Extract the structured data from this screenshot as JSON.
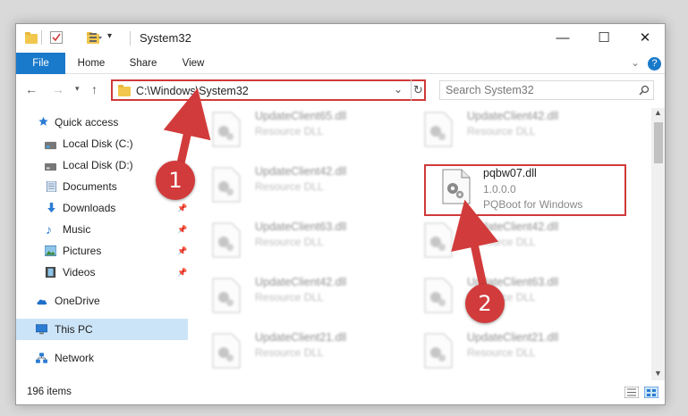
{
  "window": {
    "title": "System32",
    "minimize_glyph": "—",
    "maximize_glyph": "☐",
    "close_glyph": "✕"
  },
  "ribbon": {
    "tabs": [
      "File",
      "Home",
      "Share",
      "View"
    ],
    "expand_glyph": "⌄",
    "help_glyph": "?"
  },
  "address": {
    "path": "C:\\Windows\\System32",
    "search_placeholder": "Search System32"
  },
  "sidebar": {
    "items": [
      {
        "label": "Quick access",
        "icon": "star-icon"
      },
      {
        "label": "Local Disk (C:)",
        "icon": "drive-icon"
      },
      {
        "label": "Local Disk (D:)",
        "icon": "drive-icon"
      },
      {
        "label": "Documents",
        "icon": "documents-icon"
      },
      {
        "label": "Downloads",
        "icon": "download-arrow-icon"
      },
      {
        "label": "Music",
        "icon": "music-note-icon"
      },
      {
        "label": "Pictures",
        "icon": "pictures-icon"
      },
      {
        "label": "Videos",
        "icon": "videos-icon"
      },
      {
        "label": "OneDrive",
        "icon": "cloud-icon"
      },
      {
        "label": "This PC",
        "icon": "monitor-icon"
      },
      {
        "label": "Network",
        "icon": "network-icon"
      }
    ]
  },
  "files": {
    "left": [
      {
        "name": "UpdateClient65.dll",
        "type": "Resource DLL"
      },
      {
        "name": "UpdateClient42.dll",
        "type": "Resource DLL"
      },
      {
        "name": "UpdateClient63.dll",
        "type": "Resource DLL"
      },
      {
        "name": "UpdateClient42.dll",
        "type": "Resource DLL"
      },
      {
        "name": "UpdateClient21.dll",
        "type": "Resource DLL"
      }
    ],
    "right": [
      {
        "name": "UpdateClient42.dll",
        "type": "Resource DLL"
      },
      {
        "name": "UpdateClient42.dll",
        "type": "Resource DLL"
      },
      {
        "name": "UpdateClient63.dll",
        "type": "Resource DLL"
      },
      {
        "name": "UpdateClient21.dll",
        "type": "Resource DLL"
      }
    ],
    "selected": {
      "name": "pqbw07.dll",
      "version": "1.0.0.0",
      "description": "PQBoot for Windows"
    }
  },
  "status": {
    "item_count": "196 items"
  },
  "annotations": {
    "badge_1": "1",
    "badge_2": "2",
    "color": "#d23b3b"
  }
}
